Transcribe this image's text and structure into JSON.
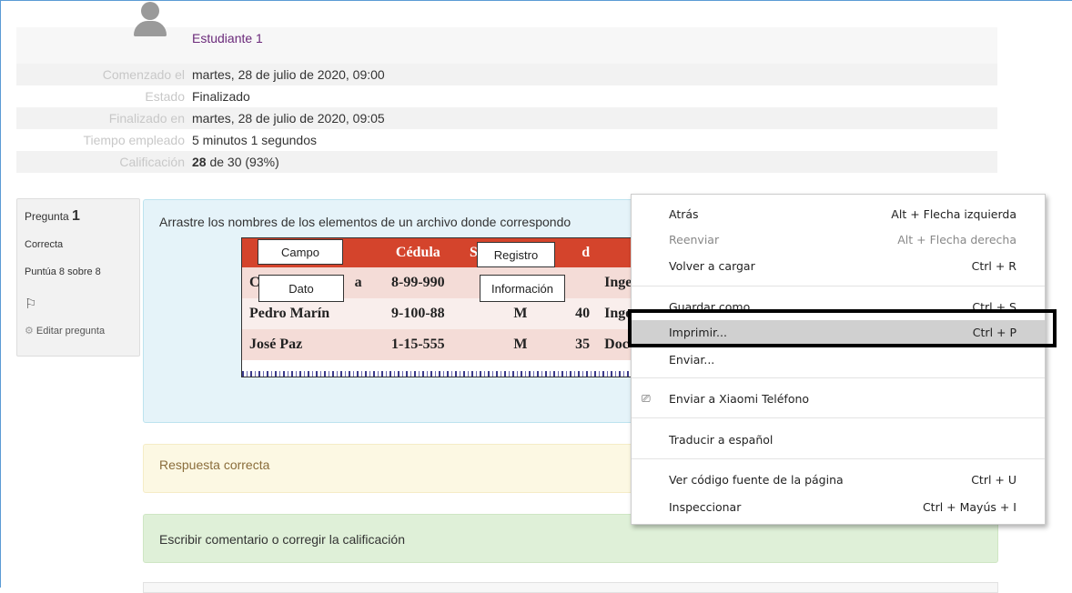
{
  "summary": {
    "user_name": "Estudiante 1",
    "rows": [
      {
        "label": "Comenzado el",
        "value": "martes, 28 de julio de 2020, 09:00"
      },
      {
        "label": "Estado",
        "value": "Finalizado"
      },
      {
        "label": "Finalizado en",
        "value": "martes, 28 de julio de 2020, 09:05"
      },
      {
        "label": "Tiempo empleado",
        "value": "5 minutos 1 segundos"
      }
    ],
    "grade_label": "Calificación",
    "grade_bold": "28",
    "grade_rest": " de 30 (93%)"
  },
  "question": {
    "prefix": "Pregunta",
    "number": "1",
    "state": "Correcta",
    "mark": "Puntúa 8 sobre 8",
    "flag_glyph": "⚐",
    "edit_label": "Editar pregunta",
    "text": "Arrastre los nombres de los elementos de un archivo donde correspondo",
    "table": {
      "header": [
        "",
        "Cédula",
        "S",
        "",
        "d",
        ""
      ],
      "rows": [
        [
          "C",
          "a",
          "8-99-990",
          "",
          "",
          "Inge"
        ],
        [
          "Pedro Marín",
          "",
          "9-100-88",
          "M",
          "40",
          "Inge"
        ],
        [
          "José Paz",
          "",
          "1-15-555",
          "M",
          "35",
          "Doc"
        ]
      ]
    },
    "drops": [
      "Campo",
      "Registro",
      "Dato",
      "Información"
    ],
    "feedback": "Respuesta correcta",
    "comment_link": "Escribir comentario o corregir la calificación"
  },
  "context_menu": {
    "items": [
      {
        "label": "Atrás",
        "shortcut": "Alt + Flecha izquierda"
      },
      {
        "label": "Reenviar",
        "shortcut": "Alt + Flecha derecha"
      },
      {
        "label": "Volver a cargar",
        "shortcut": "Ctrl + R"
      },
      {
        "label": "Guardar como...",
        "shortcut": "Ctrl + S"
      },
      {
        "label": "Imprimir...",
        "shortcut": "Ctrl + P"
      },
      {
        "label": "Enviar..."
      },
      {
        "label": "Enviar a Xiaomi Teléfono"
      },
      {
        "label": "Traducir a español"
      },
      {
        "label": "Ver código fuente de la página",
        "shortcut": "Ctrl + U"
      },
      {
        "label": "Inspeccionar",
        "shortcut": "Ctrl + Mayús + I"
      }
    ]
  }
}
